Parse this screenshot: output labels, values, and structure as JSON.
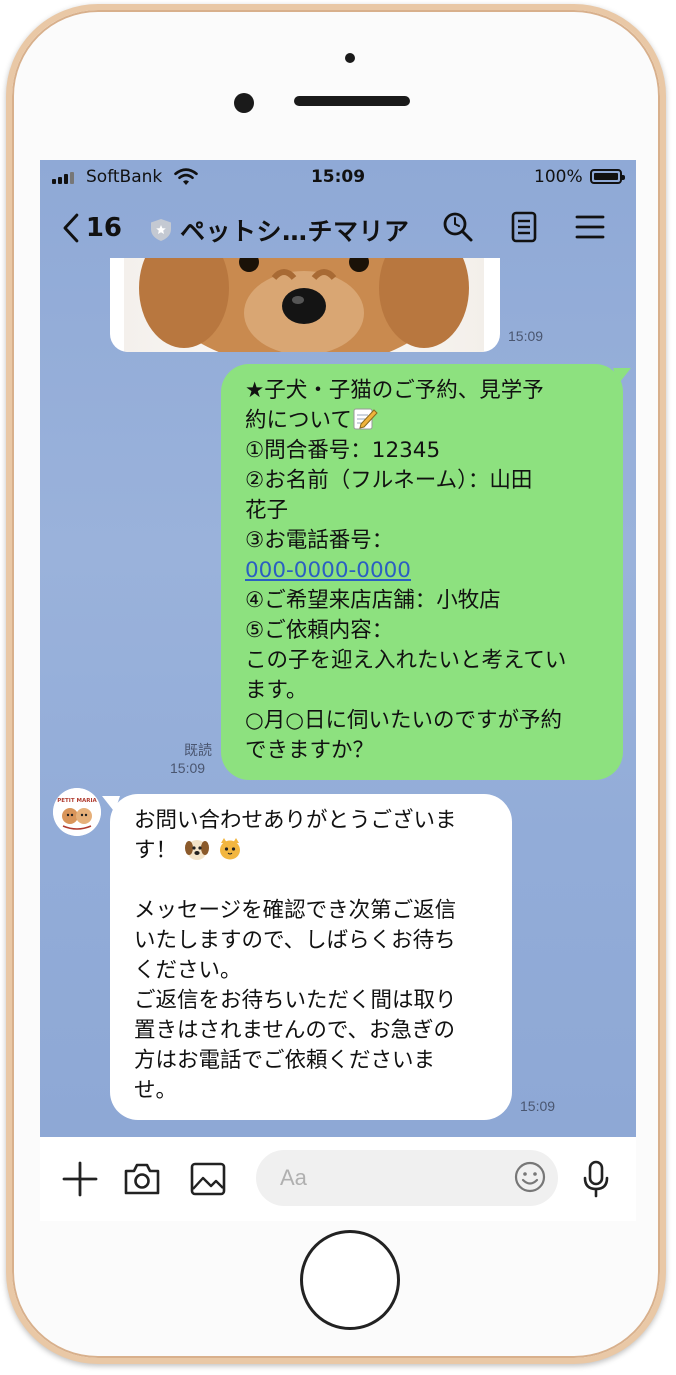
{
  "status_bar": {
    "carrier": "SoftBank",
    "time": "15:09",
    "battery": "100%"
  },
  "header": {
    "back_count": "16",
    "title": "ペットシ…チマリア",
    "icons": [
      "back-chevron-icon",
      "shield-icon",
      "search-icon",
      "notes-icon",
      "menu-icon"
    ]
  },
  "messages": [
    {
      "type": "image",
      "direction": "incoming",
      "time": "15:09"
    },
    {
      "type": "text",
      "direction": "outgoing",
      "read": "既読",
      "time": "15:09",
      "lines": [
        "★子犬・子猫のご予約、見学予",
        "約について",
        "①問合番号：12345",
        "②お名前（フルネーム）：山田",
        "花子",
        "③お電話番号：",
        "000-0000-0000",
        "④ご希望来店店舗：小牧店",
        "⑤ご依頼内容：",
        "この子を迎え入れたいと考えてい",
        "ます。",
        "○月○日に伺いたいのですが予約",
        "できますか？"
      ]
    },
    {
      "type": "text",
      "direction": "incoming",
      "sender_logo_text": "PETIT MARIA",
      "time": "15:09",
      "lines": [
        "お問い合わせありがとうございま",
        "す！",
        "",
        "メッセージを確認でき次第ご返信",
        "いたしますので、しばらくお待ち",
        "ください。",
        "ご返信をお待ちいただく間は取り",
        "置きはされませんので、お急ぎの",
        "方はお電話でご依頼くださいま",
        "せ。"
      ]
    }
  ],
  "input_bar": {
    "placeholder": "Aa",
    "icons": [
      "plus-icon",
      "camera-icon",
      "image-icon",
      "emoji-icon",
      "microphone-icon"
    ]
  },
  "colors": {
    "chat_background": "#92acd8",
    "outgoing_bubble": "#8de17f",
    "incoming_bubble": "#ffffff",
    "phone_frame": "#e9c8a6",
    "link": "#2b5fc2"
  }
}
